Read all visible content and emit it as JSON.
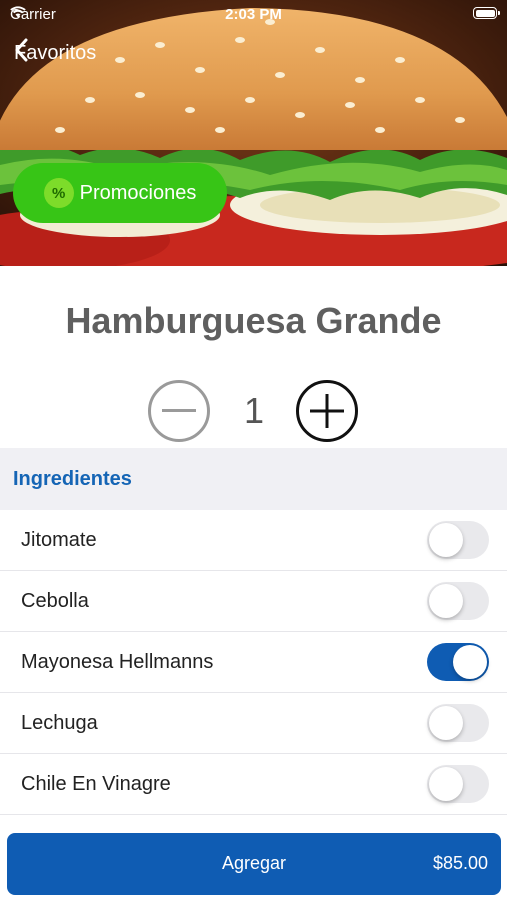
{
  "status_bar": {
    "carrier": "Carrier",
    "time": "2:03 PM"
  },
  "nav": {
    "back_label": "Favoritos"
  },
  "promo": {
    "badge": "%",
    "label": "Promociones"
  },
  "product": {
    "title": "Hamburguesa Grande",
    "quantity": "1"
  },
  "ingredients": {
    "header": "Ingredientes",
    "items": [
      {
        "label": "Jitomate",
        "enabled": false
      },
      {
        "label": "Cebolla",
        "enabled": false
      },
      {
        "label": "Mayonesa Hellmanns",
        "enabled": true
      },
      {
        "label": "Lechuga",
        "enabled": false
      },
      {
        "label": "Chile En Vinagre",
        "enabled": false
      }
    ]
  },
  "cart": {
    "add_label": "Agregar",
    "price": "$85.00"
  },
  "colors": {
    "accent": "#0f5cb3",
    "promo_green": "#37c516",
    "header_blue": "#1565b5"
  }
}
